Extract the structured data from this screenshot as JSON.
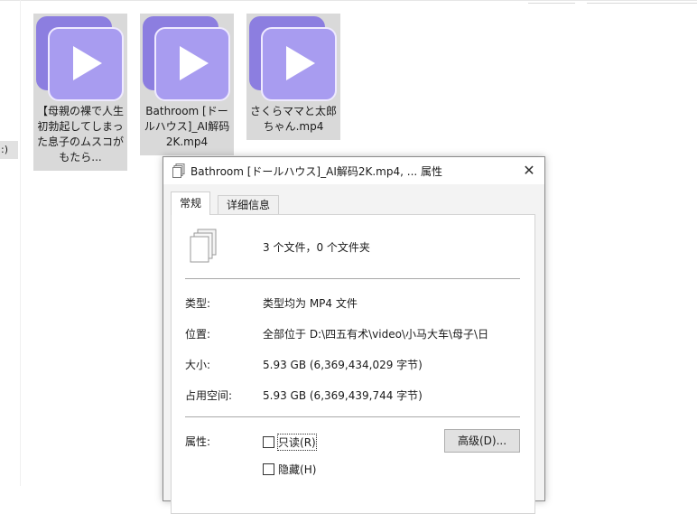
{
  "files": [
    {
      "name": "【母親の裸で人生初勃起してしまった息子のムスコがもたら..."
    },
    {
      "name": "Bathroom [ドールハウス]_AI解码2K.mp4"
    },
    {
      "name": "さくらママと太郎ちゃん.mp4"
    }
  ],
  "left_stub": ":)",
  "dialog": {
    "title": "Bathroom [ドールハウス]_AI解码2K.mp4, ... 属性",
    "close_glyph": "✕",
    "tabs": [
      {
        "label": "常规",
        "active": true
      },
      {
        "label": "详细信息",
        "active": false
      }
    ],
    "summary": "3 个文件，0 个文件夹",
    "rows": [
      {
        "label": "类型:",
        "value": "类型均为 MP4 文件"
      },
      {
        "label": "位置:",
        "value": "全部位于 D:\\四五有术\\video\\小马大车\\母子\\日"
      },
      {
        "label": "大小:",
        "value": "5.93 GB (6,369,434,029 字节)"
      },
      {
        "label": "占用空间:",
        "value": "5.93 GB (6,369,439,744 字节)"
      }
    ],
    "attributes": {
      "label": "属性:",
      "readonly": {
        "text": "只读",
        "key": "(R)",
        "checked": false
      },
      "hidden": {
        "text": "隐藏",
        "key": "(H)",
        "checked": false
      },
      "advanced_button": "高级(D)..."
    }
  },
  "colors": {
    "video_icon_back": "#8c7ee0",
    "video_icon_front": "#a89cf0",
    "tile_selected": "#d9d9d9"
  },
  "icons": [
    "video-file-icon",
    "play-icon",
    "multi-document-icon",
    "close-icon",
    "checkbox-icon"
  ]
}
